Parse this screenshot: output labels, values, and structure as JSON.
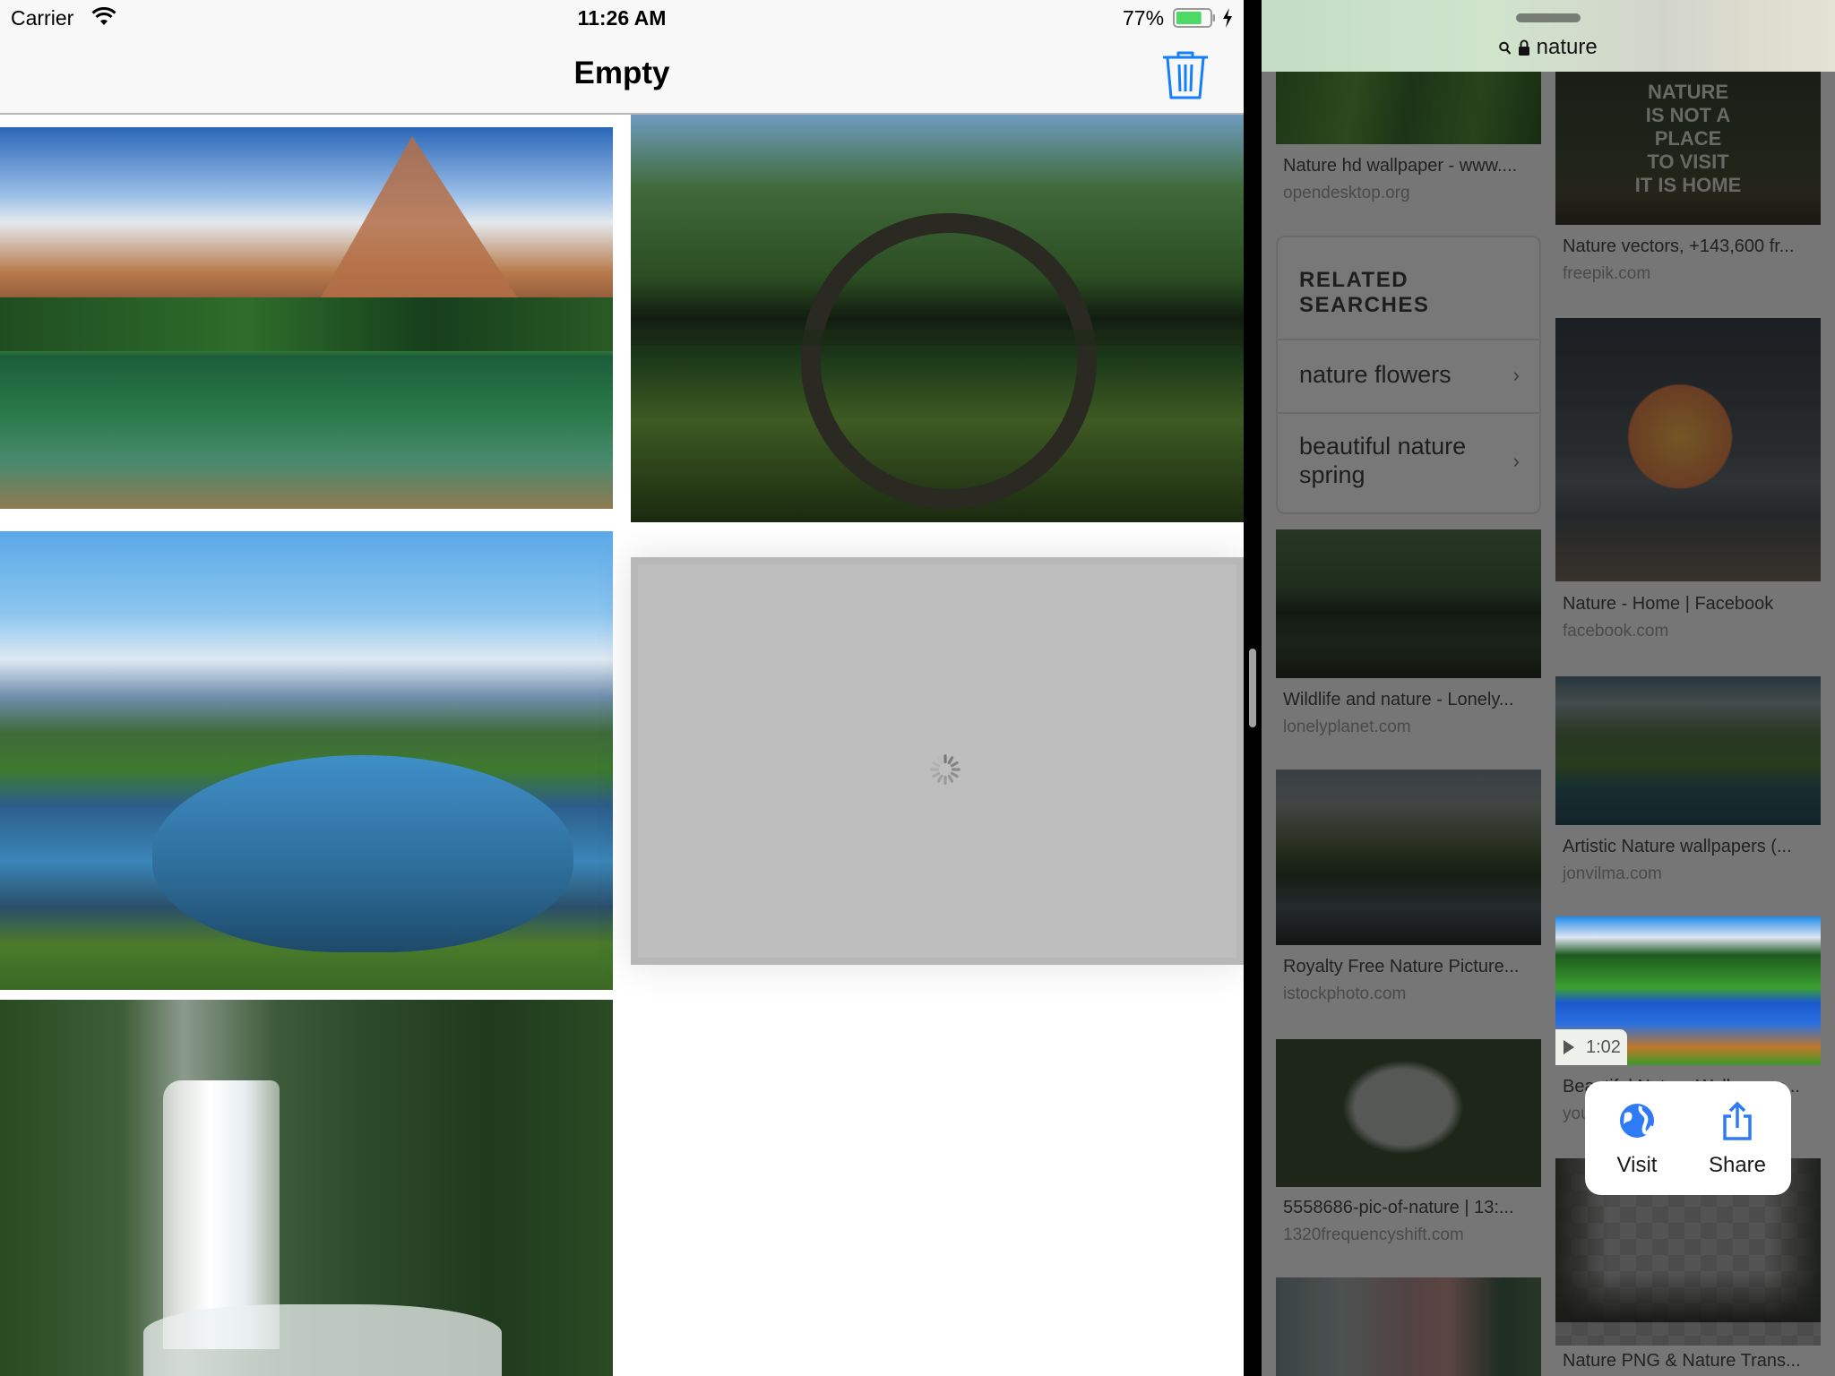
{
  "status_bar": {
    "carrier": "Carrier",
    "time": "11:26 AM",
    "battery_percent": "77%",
    "battery_level": 0.77,
    "battery_color": "#4cd964",
    "charging": true
  },
  "nav_bar": {
    "title": "Empty",
    "trash_icon": "trash-icon",
    "accent_color": "#147efb"
  },
  "gallery": {
    "photos": [
      {
        "description": "mountain lake with rocky peaks"
      },
      {
        "description": "stone arch bridge reflected in lake"
      },
      {
        "description": "alpine lake with snowy mountains"
      },
      {
        "description": "rainforest waterfall"
      }
    ],
    "loading_cell": {
      "state": "loading",
      "icon": "spinner-icon"
    }
  },
  "browser": {
    "search_icon": "search-icon",
    "lock_icon": "lock-icon",
    "query": "nature",
    "related": {
      "heading": "RELATED SEARCHES",
      "items": [
        {
          "label": "nature flowers"
        },
        {
          "label": "beautiful nature spring"
        }
      ]
    },
    "results_left": [
      {
        "title": "Nature hd wallpaper - www....",
        "domain": "opendesktop.org"
      },
      {
        "title": "Wildlife and nature - Lonely...",
        "domain": "lonelyplanet.com"
      },
      {
        "title": "Royalty Free Nature Picture...",
        "domain": "istockphoto.com"
      },
      {
        "title": "5558686-pic-of-nature | 13:...",
        "domain": "1320frequencyshift.com"
      },
      {
        "title": "",
        "domain": ""
      }
    ],
    "results_right": [
      {
        "title": "Nature vectors, +143,600 fr...",
        "domain": "freepik.com"
      },
      {
        "title": "Nature - Home | Facebook",
        "domain": "facebook.com"
      },
      {
        "title": "Artistic Nature wallpapers (...",
        "domain": "jonvilma.com"
      },
      {
        "title": "Beautiful Nature Wallpapers...",
        "domain": "youtube.com",
        "video_duration": "1:02"
      },
      {
        "title": "Nature PNG & Nature Trans...",
        "domain": ""
      }
    ],
    "context_menu": {
      "visit_label": "Visit",
      "share_label": "Share",
      "icon_color": "#2f7af5"
    }
  }
}
